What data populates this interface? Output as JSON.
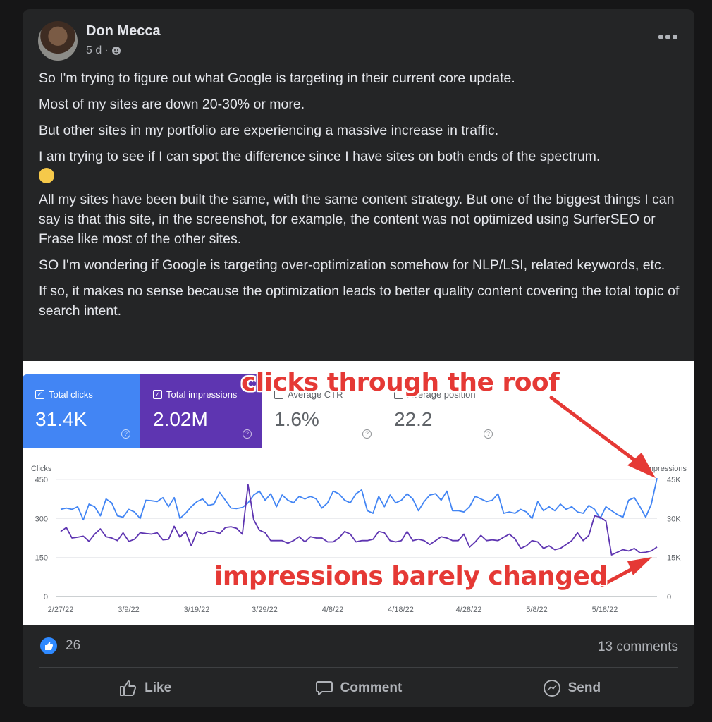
{
  "post": {
    "author": "Don Mecca",
    "time": "5 d",
    "dot": "·",
    "more": "•••",
    "paragraphs": [
      "So I'm trying to figure out what Google is targeting in their current core update.",
      "Most of my sites are down 20-30% or more.",
      "But other sites in my portfolio are experiencing a massive increase in traffic.",
      "I am trying to see if I can spot the difference since I have sites on both ends of the spectrum.",
      "All my sites have been built the same, with the same content strategy. But one of the biggest things I can say is that this site, in the screenshot, for example, the content was not optimized using SurferSEO or Frase like most of the other sites.",
      "SO I'm wondering if Google is targeting over-optimization somehow for NLP/LSI, related keywords, etc.",
      "If so, it makes no sense because the optimization leads to better quality content covering the total topic of search intent."
    ]
  },
  "metrics": [
    {
      "label": "Total clicks",
      "value": "31.4K",
      "color": "#4285f4"
    },
    {
      "label": "Total impressions",
      "value": "2.02M",
      "color": "#5e35b1"
    },
    {
      "label": "Average CTR",
      "value": "1.6%"
    },
    {
      "label": "Average position",
      "value": "22.2"
    }
  ],
  "annotations": {
    "top": "clicks through the roof",
    "bottom": "impressions barely changed",
    "color": "#e53935"
  },
  "chart_data": {
    "type": "line",
    "left_axis_label": "Clicks",
    "right_axis_label": "Impressions",
    "left_ticks": [
      "450",
      "300",
      "150",
      "0"
    ],
    "right_ticks": [
      "45K",
      "30K",
      "15K",
      "0"
    ],
    "ylim_left": [
      0,
      450
    ],
    "ylim_right": [
      0,
      45000
    ],
    "x_ticks": [
      "2/27/22",
      "3/9/22",
      "3/19/22",
      "3/29/22",
      "4/8/22",
      "4/18/22",
      "4/28/22",
      "5/8/22",
      "5/18/22"
    ],
    "series": [
      {
        "name": "Total clicks",
        "color": "#4285f4",
        "axis": "left",
        "values": [
          335,
          340,
          335,
          345,
          295,
          355,
          345,
          310,
          375,
          360,
          310,
          305,
          335,
          325,
          300,
          370,
          368,
          365,
          380,
          345,
          380,
          300,
          320,
          345,
          365,
          375,
          350,
          355,
          400,
          370,
          340,
          338,
          342,
          360,
          390,
          405,
          370,
          395,
          345,
          390,
          370,
          360,
          385,
          375,
          385,
          375,
          340,
          360,
          405,
          395,
          370,
          360,
          395,
          410,
          330,
          320,
          385,
          345,
          390,
          360,
          370,
          395,
          375,
          330,
          365,
          390,
          395,
          370,
          405,
          330,
          330,
          325,
          345,
          385,
          375,
          365,
          370,
          395,
          320,
          325,
          320,
          335,
          325,
          300,
          365,
          330,
          345,
          330,
          355,
          335,
          345,
          325,
          320,
          350,
          335,
          300,
          345,
          330,
          315,
          305,
          370,
          380,
          345,
          305,
          355,
          455
        ]
      },
      {
        "name": "Total impressions",
        "color": "#5e35b1",
        "axis": "left",
        "values": [
          250,
          265,
          225,
          228,
          232,
          212,
          240,
          260,
          230,
          225,
          215,
          245,
          212,
          220,
          245,
          242,
          240,
          245,
          218,
          220,
          270,
          228,
          250,
          195,
          250,
          240,
          250,
          250,
          242,
          265,
          268,
          262,
          240,
          430,
          295,
          255,
          245,
          215,
          215,
          215,
          205,
          215,
          230,
          210,
          230,
          225,
          225,
          210,
          210,
          225,
          250,
          240,
          210,
          215,
          215,
          220,
          250,
          245,
          215,
          210,
          215,
          250,
          215,
          220,
          215,
          200,
          215,
          230,
          225,
          215,
          215,
          240,
          190,
          210,
          235,
          215,
          218,
          215,
          228,
          240,
          222,
          185,
          195,
          215,
          210,
          185,
          195,
          180,
          185,
          200,
          215,
          245,
          215,
          235,
          310,
          305,
          290,
          160,
          170,
          180,
          175,
          185,
          168,
          170,
          175,
          190
        ]
      }
    ]
  },
  "footer": {
    "like_count": "26",
    "comments": "13 comments",
    "like": "Like",
    "comment": "Comment",
    "send": "Send"
  }
}
